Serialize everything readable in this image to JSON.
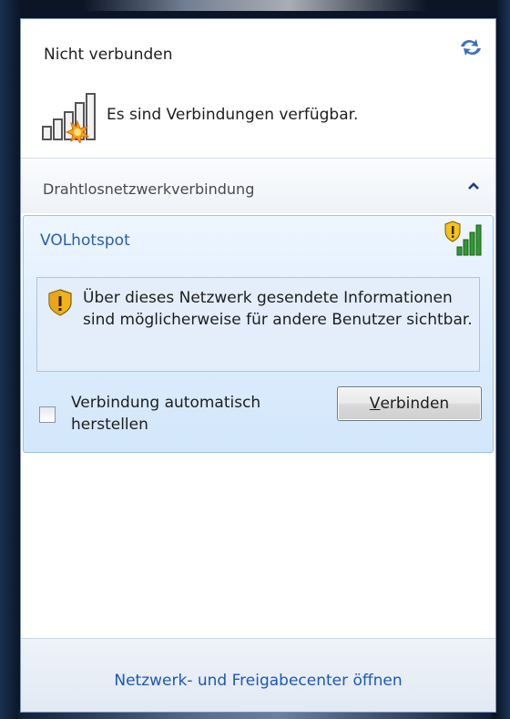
{
  "header": {
    "title": "Nicht verbunden",
    "status_text": "Es sind Verbindungen verfügbar.",
    "refresh_icon": "refresh-icon",
    "status_icon": "signal-bars-warning-icon"
  },
  "section": {
    "label": "Drahtlosnetzwerkverbindung",
    "toggle_icon": "chevron-up-icon"
  },
  "network": {
    "name": "VOLhotspot",
    "signal_icon": "signal-strength-shield-icon",
    "warning_icon": "security-warning-shield-icon",
    "warning_text": "Über dieses Netzwerk gesendete Informationen sind möglicherweise für andere Benutzer sichtbar.",
    "auto_connect_label": "Verbindung automatisch herstellen",
    "auto_connect_checked": false,
    "connect_button_mnemonic": "V",
    "connect_button_rest": "erbinden"
  },
  "footer": {
    "link_label": "Netzwerk- und Freigabecenter öffnen"
  },
  "colors": {
    "link": "#1e57b8",
    "network_name": "#2a5db4",
    "selected_card": "#d3e7fb"
  }
}
